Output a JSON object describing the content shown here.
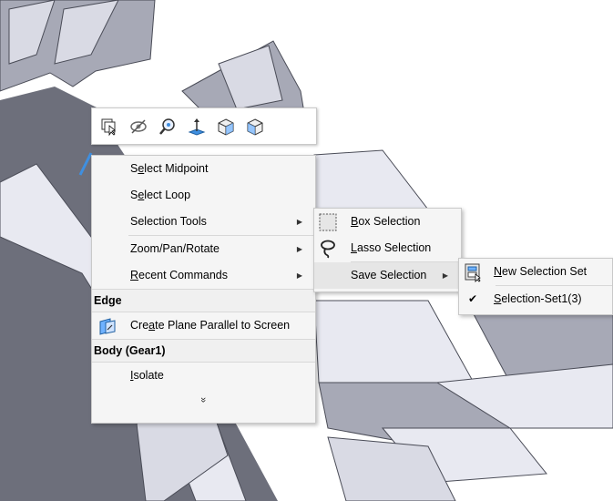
{
  "toolbar": {
    "icons": [
      "select-other-icon",
      "hide-icon",
      "zoom-to-selection-icon",
      "normal-to-icon",
      "isometric-view-icon",
      "view-orientation-icon"
    ]
  },
  "context_menu": {
    "items": [
      {
        "label_pre": "S",
        "label_u": "e",
        "label_post": "lect Midpoint"
      },
      {
        "label_pre": "S",
        "label_u": "e",
        "label_post": "lect Loop"
      },
      {
        "label_pre": "Selection Tools",
        "label_u": "",
        "label_post": ""
      },
      {
        "label_pre": "Zoom/Pan/Rotate",
        "label_u": "",
        "label_post": ""
      },
      {
        "label_pre": "",
        "label_u": "R",
        "label_post": "ecent Commands"
      }
    ],
    "edge_header": "Edge",
    "create_plane": {
      "label_pre": "Cre",
      "label_u": "a",
      "label_post": "te Plane Parallel to Screen"
    },
    "body_header": "Body (Gear1)",
    "isolate": {
      "label_pre": "",
      "label_u": "I",
      "label_post": "solate"
    },
    "expand_glyph": "»"
  },
  "selection_tools_menu": {
    "box": {
      "u": "B",
      "rest": "ox Selection"
    },
    "lasso": {
      "u": "L",
      "rest": "asso Selection"
    },
    "save": {
      "label": "Save Selection"
    }
  },
  "save_selection_menu": {
    "new_set": {
      "u": "N",
      "rest": "ew Selection Set"
    },
    "set1": {
      "u": "S",
      "rest": "election-Set1(3)"
    },
    "check": "✔"
  },
  "colors": {
    "gear_dark": "#6d6f7b",
    "gear_mid": "#a7a9b6",
    "gear_light": "#e8e9f1",
    "selected_edge": "#3f8fe0"
  }
}
